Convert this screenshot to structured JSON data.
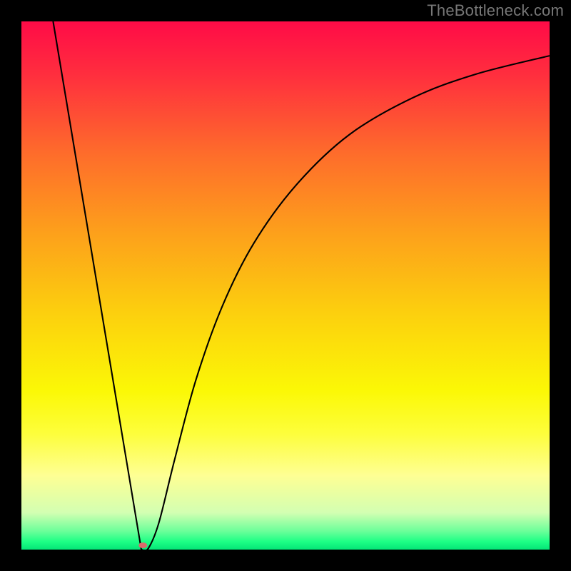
{
  "watermark": "TheBottleneck.com",
  "chart_data": {
    "type": "line",
    "title": "",
    "xlabel": "",
    "ylabel": "",
    "x_range": [
      0,
      100
    ],
    "y_range": [
      0,
      100
    ],
    "grid": false,
    "background": {
      "type": "vertical-gradient",
      "stops": [
        {
          "offset": 0.0,
          "color": "#ff0b47"
        },
        {
          "offset": 0.1,
          "color": "#ff2e3e"
        },
        {
          "offset": 0.25,
          "color": "#fe6c2b"
        },
        {
          "offset": 0.4,
          "color": "#fda01b"
        },
        {
          "offset": 0.55,
          "color": "#fccf0e"
        },
        {
          "offset": 0.7,
          "color": "#fbf806"
        },
        {
          "offset": 0.78,
          "color": "#fdfe3b"
        },
        {
          "offset": 0.86,
          "color": "#feff94"
        },
        {
          "offset": 0.93,
          "color": "#d3ffb2"
        },
        {
          "offset": 0.965,
          "color": "#6cff9a"
        },
        {
          "offset": 0.985,
          "color": "#1dff85"
        },
        {
          "offset": 1.0,
          "color": "#04e577"
        }
      ]
    },
    "series": [
      {
        "name": "bottleneck-curve",
        "color": "#000000",
        "width": 2.1,
        "segments": [
          {
            "kind": "line",
            "from": {
              "x": 6.0,
              "y": 100.0
            },
            "to": {
              "x": 22.7,
              "y": 0.0
            }
          },
          {
            "kind": "curve",
            "points": [
              {
                "x": 22.7,
                "y": 0.0
              },
              {
                "x": 24.0,
                "y": 0.2
              },
              {
                "x": 26.0,
                "y": 5.0
              },
              {
                "x": 29.0,
                "y": 17.0
              },
              {
                "x": 33.0,
                "y": 32.0
              },
              {
                "x": 38.0,
                "y": 46.0
              },
              {
                "x": 44.0,
                "y": 58.0
              },
              {
                "x": 52.0,
                "y": 69.0
              },
              {
                "x": 62.0,
                "y": 78.5
              },
              {
                "x": 74.0,
                "y": 85.5
              },
              {
                "x": 86.0,
                "y": 90.0
              },
              {
                "x": 100.0,
                "y": 93.5
              }
            ]
          }
        ]
      }
    ],
    "marker": {
      "x": 23.0,
      "y": 0.8,
      "rx": 6,
      "ry": 4,
      "color": "#d86b6b"
    },
    "annotations": []
  }
}
